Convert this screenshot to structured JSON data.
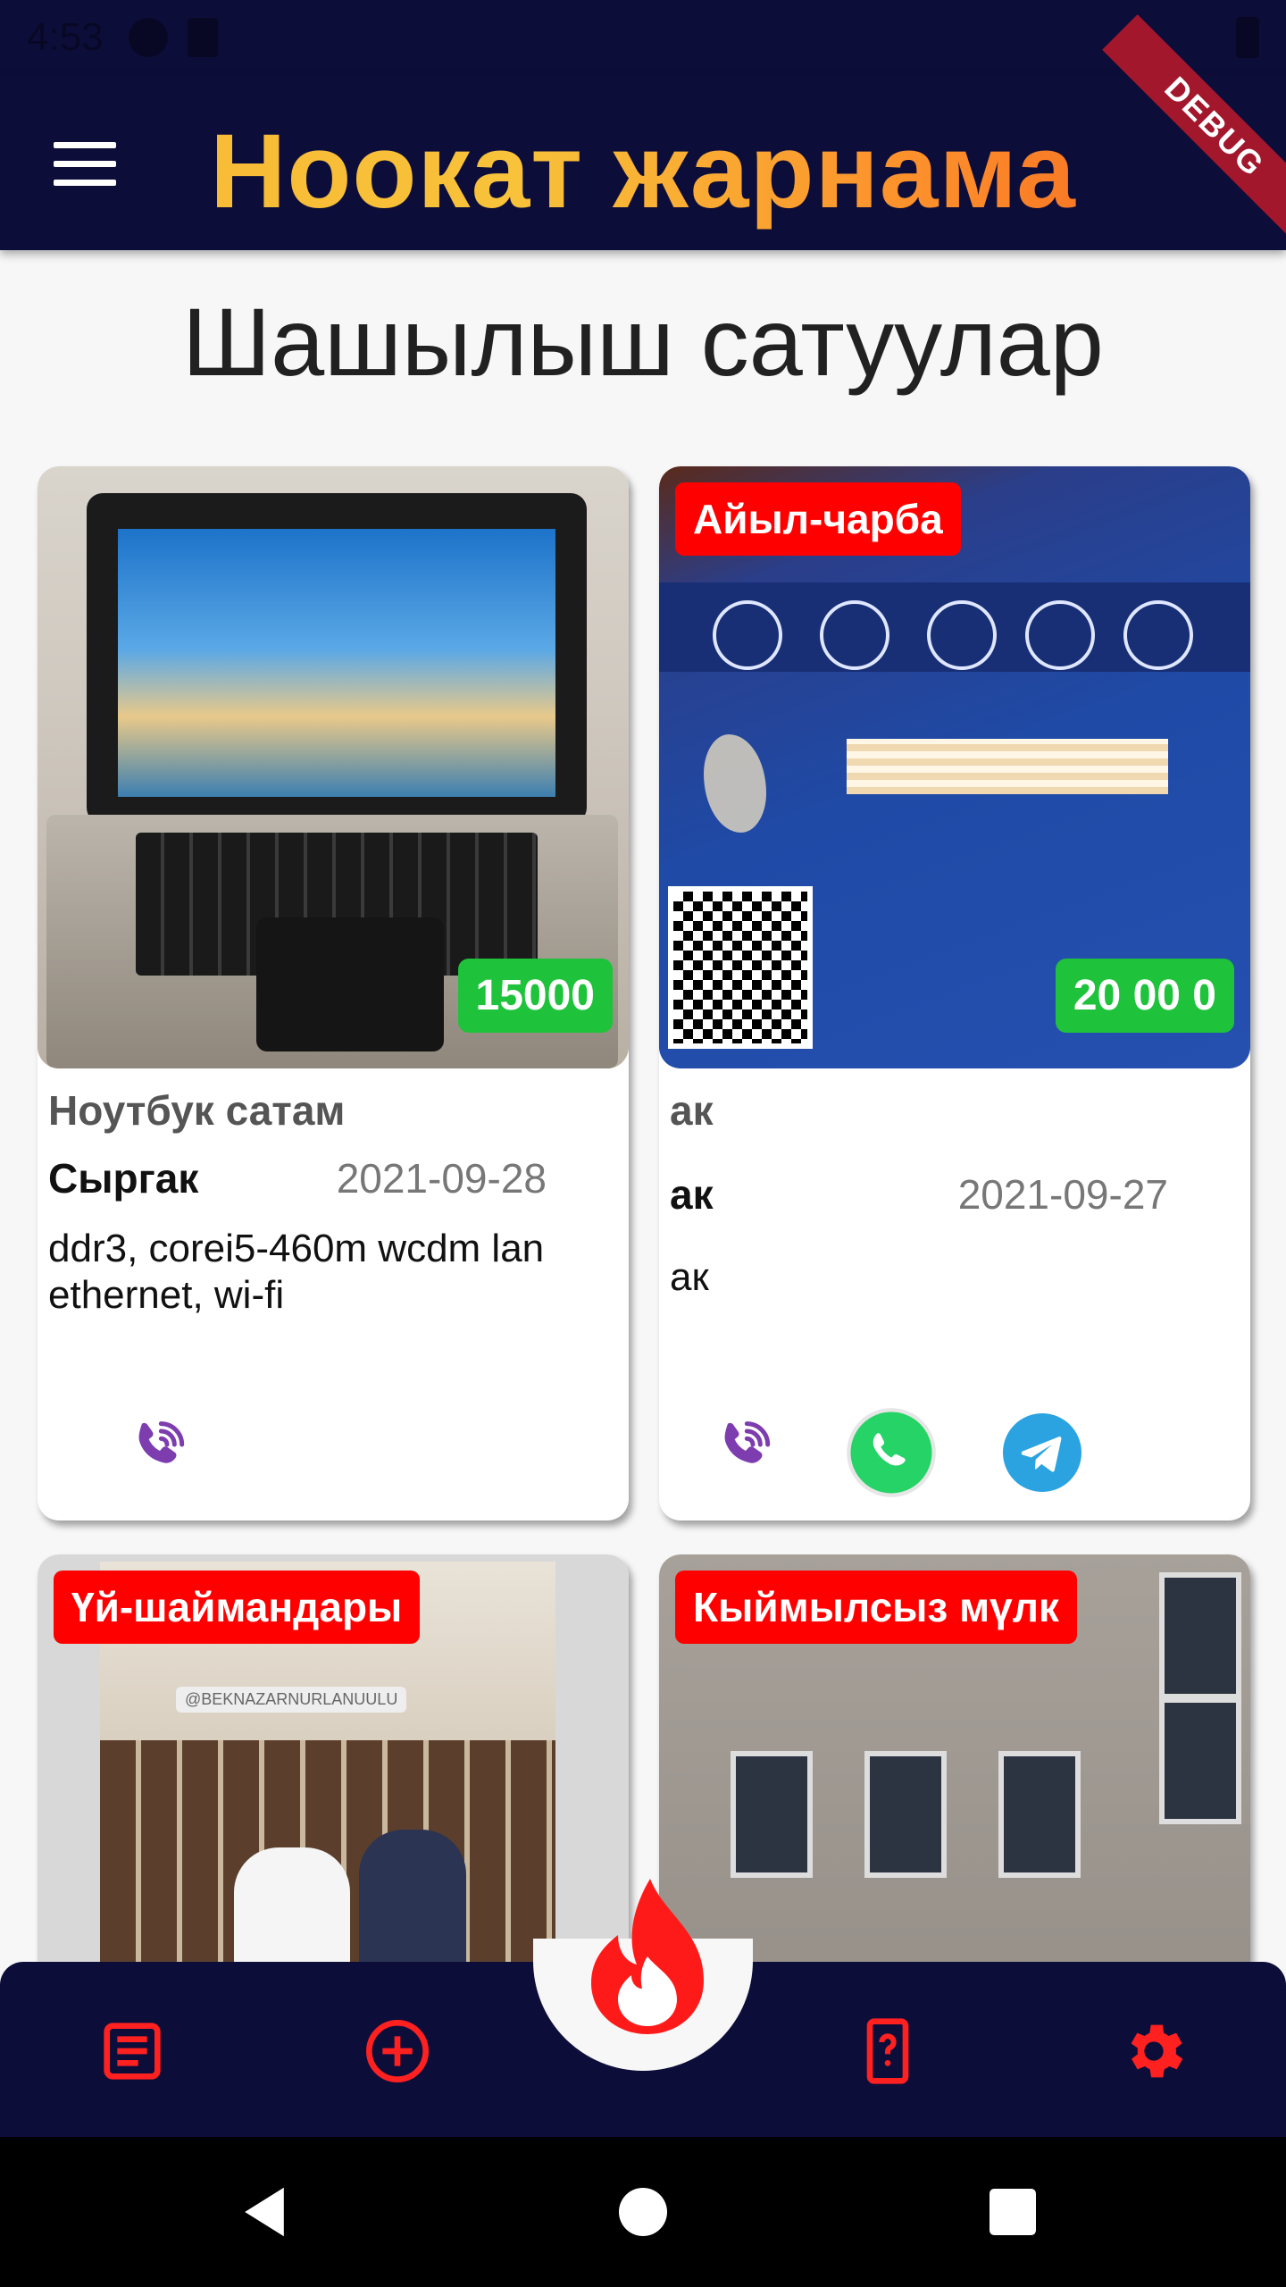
{
  "status_bar": {
    "time": "4:53"
  },
  "debug_banner": "DEBUG",
  "app_bar": {
    "title": "Ноокат жарнама",
    "menu_icon": "hamburger-menu-icon"
  },
  "page_title": "Шашылыш сатуулар",
  "listings": [
    {
      "category": "",
      "price": "15000",
      "title": "Ноутбук сатам",
      "seller": "Сыргак",
      "date": "2021-09-28",
      "description": "ddr3, corei5-460m wcdm lan ethernet, wi-fi",
      "contacts": [
        "viber"
      ]
    },
    {
      "category": "Айыл-чарба",
      "price": "20 00 0",
      "title": "ак",
      "seller": "ак",
      "date": "2021-09-27",
      "description": "ак",
      "contacts": [
        "viber",
        "whatsapp",
        "telegram"
      ]
    },
    {
      "category": "Үй-шаймандары",
      "photo_caption": "@BEKNAZARNURLANUULU"
    },
    {
      "category": "Кыймылсыз мүлк"
    }
  ],
  "colors": {
    "app_bar": "#0d0d3a",
    "badge": "#ff0000",
    "price": "#1fc23b",
    "viber": "#7d3daf",
    "whatsapp": "#25d366",
    "telegram": "#2aa3e0",
    "nav_icons": "#ff2020"
  },
  "bottom_nav": {
    "items": [
      "list-icon",
      "add-circle-icon",
      "fire-icon",
      "help-phone-icon",
      "settings-gear-icon"
    ]
  },
  "system_nav": [
    "back-icon",
    "home-icon",
    "recents-icon"
  ]
}
